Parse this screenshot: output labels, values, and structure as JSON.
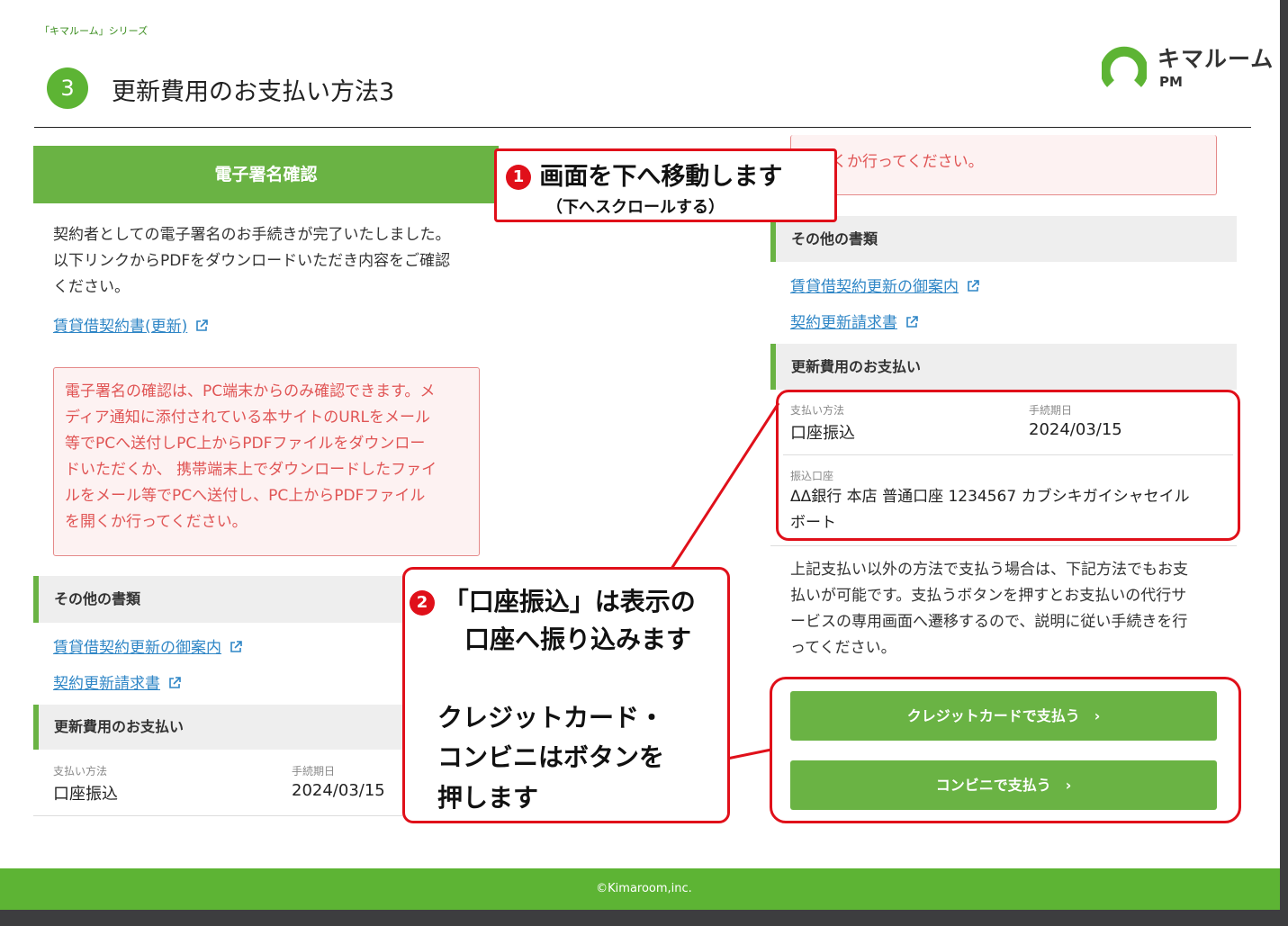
{
  "header": {
    "series": "「キマルーム」シリーズ",
    "step_number": "3",
    "title": "更新費用のお支払い方法3",
    "logo_text": "キマルーム",
    "logo_sub": "PM"
  },
  "left": {
    "signature_heading": "電子署名確認",
    "signature_text": [
      "契約者としての電子署名のお手続きが完了いたしました。",
      "以下リンクからPDFをダウンロードいただき内容をご確認",
      "ください。"
    ],
    "contract_link": "賃貸借契約書(更新)",
    "warning_lines": [
      "電子署名の確認は、PC端末からのみ確認できます。メ",
      "ディア通知に添付されている本サイトのURLをメール",
      "等でPCへ送付しPC上からPDFファイルをダウンロー",
      "ドいただくか、 携帯端末上でダウンロードしたファイ",
      "ルをメール等でPCへ送付し、PC上からPDFファイル",
      "を開くか行ってください。"
    ],
    "other_docs_heading": "その他の書類",
    "doc_link_1": "賃貸借契約更新の御案内",
    "doc_link_2": "契約更新請求書",
    "payment_heading": "更新費用のお支払い",
    "method_label": "支払い方法",
    "method_value": "口座振込",
    "due_label": "手続期日",
    "due_value": "2024/03/15"
  },
  "right": {
    "warning_tail": "くか行ってください。",
    "other_docs_heading": "その他の書類",
    "doc_link_1": "賃貸借契約更新の御案内",
    "doc_link_2": "契約更新請求書",
    "payment_heading": "更新費用のお支払い",
    "method_label": "支払い方法",
    "method_value": "口座振込",
    "due_label": "手続期日",
    "due_value": "2024/03/15",
    "account_label": "振込口座",
    "account_lines": [
      "ΔΔ銀行 本店 普通口座 1234567 カブシキガイシャセイル",
      "ボート"
    ],
    "other_method_lines": [
      "上記支払い以外の方法で支払う場合は、下記方法でもお支",
      "払いが可能です。支払うボタンを押すとお支払いの代行サ",
      "ービスの専用画面へ遷移するので、説明に従い手続きを行",
      "ってください。"
    ],
    "credit_button": "クレジットカードで支払う　›",
    "conveni_button": "コンビニで支払う　›"
  },
  "callouts": {
    "c1_number": "1",
    "c1_title": "画面を下へ移動します",
    "c1_sub": "（下へスクロールする）",
    "c2_number": "2",
    "c2_line1": "「口座振込」は表示の",
    "c2_line2": "口座へ振り込みます",
    "c2_line3": "クレジットカード・",
    "c2_line4": "コンビニはボタンを",
    "c2_line5": "押します"
  },
  "footer": {
    "copyright": "©Kimaroom,inc."
  },
  "colors": {
    "brand_green": "#6ab344",
    "alert_red": "#e0101a",
    "link_blue": "#2f86c6",
    "warn_text": "#e05555"
  },
  "icons": [
    "external-link-icon",
    "chevron-right-icon"
  ]
}
